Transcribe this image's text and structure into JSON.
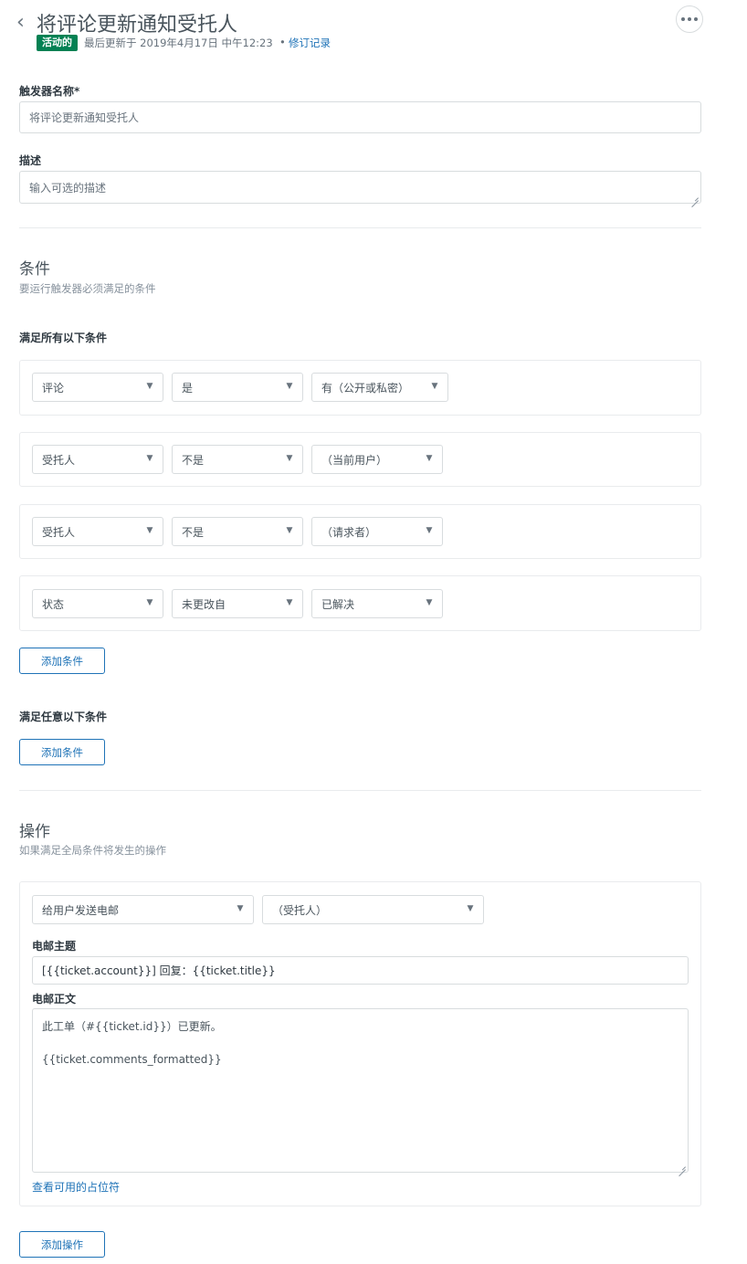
{
  "header": {
    "title": "将评论更新通知受托人",
    "status": "活动的",
    "last_updated": "最后更新于 2019年4月17日 中午12:23",
    "separator": "•",
    "revision_link": "修订记录"
  },
  "form": {
    "name_label": "触发器名称*",
    "name_value": "将评论更新通知受托人",
    "description_label": "描述",
    "description_placeholder": "输入可选的描述"
  },
  "conditions": {
    "title": "条件",
    "description": "要运行触发器必须满足的条件",
    "all_label": "满足所有以下条件",
    "all_rows": [
      {
        "field": "评论",
        "operator": "是",
        "value": "有（公开或私密）"
      },
      {
        "field": "受托人",
        "operator": "不是",
        "value": "（当前用户）"
      },
      {
        "field": "受托人",
        "operator": "不是",
        "value": "（请求者）"
      },
      {
        "field": "状态",
        "operator": "未更改自",
        "value": "已解决"
      }
    ],
    "add_condition_all": "添加条件",
    "any_label": "满足任意以下条件",
    "add_condition_any": "添加条件"
  },
  "actions": {
    "title": "操作",
    "description": "如果满足全局条件将发生的操作",
    "action_type": "给用户发送电邮",
    "recipient": "（受托人）",
    "subject_label": "电邮主题",
    "subject_value": "[{{ticket.account}}] 回复：{{ticket.title}}",
    "body_label": "电邮正文",
    "body_line1": "此工单（#{{ticket.id}}）已更新。",
    "body_line2": "{{ticket.comments_formatted}}",
    "placeholders_link": "查看可用的占位符",
    "add_action": "添加操作"
  },
  "colors": {
    "accent": "#1f73b7",
    "status_green": "#038153",
    "border": "#d8dcde"
  },
  "icons": {
    "back": "chevron-left-icon",
    "more": "ellipsis-icon",
    "dropdown": "chevron-down-icon"
  }
}
